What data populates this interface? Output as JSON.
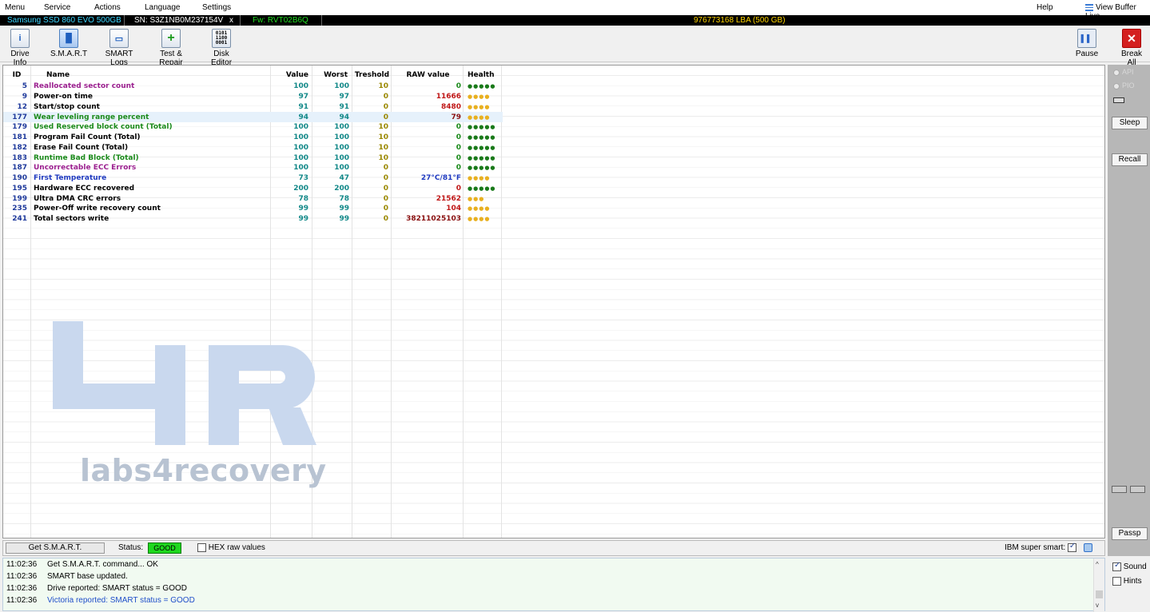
{
  "menu": [
    "Menu",
    "Service",
    "Actions",
    "Language",
    "Settings"
  ],
  "menu_right": {
    "help": "Help",
    "view_buffer": "View Buffer Live"
  },
  "drive": {
    "model": "Samsung SSD 860 EVO 500GB",
    "serial": "SN: S3Z1NB0M237154V",
    "close": "x",
    "firmware": "Fw: RVT02B6Q",
    "lba": "976773168 LBA (500 GB)"
  },
  "toolbar": {
    "drive_info": "Drive Info",
    "smart": "S.M.A.R.T",
    "smart_logs": "SMART Logs",
    "test_repair": "Test & Repair",
    "disk_editor": "Disk Editor",
    "pause": "Pause",
    "break_all": "Break All"
  },
  "table": {
    "headers": [
      "ID",
      "Name",
      "Value",
      "Worst",
      "Treshold",
      "RAW value",
      "Health"
    ],
    "rows": [
      {
        "id": "5",
        "name": "Reallocated sector count",
        "value": "100",
        "worst": "100",
        "threshold": "10",
        "raw": "0",
        "health": "●●●●●",
        "name_color": "#9b1f8f",
        "raw_color": "#1a8a1a",
        "health_color": "#1a7a1a"
      },
      {
        "id": "9",
        "name": "Power-on time",
        "value": "97",
        "worst": "97",
        "threshold": "0",
        "raw": "11666",
        "health": "●●●●",
        "name_color": "#000000",
        "raw_color": "#c01818",
        "health_color": "#e8b020"
      },
      {
        "id": "12",
        "name": "Start/stop count",
        "value": "91",
        "worst": "91",
        "threshold": "0",
        "raw": "8480",
        "health": "●●●●",
        "name_color": "#000000",
        "raw_color": "#c01818",
        "health_color": "#e8b020"
      },
      {
        "id": "177",
        "name": "Wear leveling range percent",
        "value": "94",
        "worst": "94",
        "threshold": "0",
        "raw": "79",
        "health": "●●●●",
        "name_color": "#1a8a1a",
        "raw_color": "#8a1010",
        "health_color": "#e8b020"
      },
      {
        "id": "179",
        "name": "Used Reserved block count (Total)",
        "value": "100",
        "worst": "100",
        "threshold": "10",
        "raw": "0",
        "health": "●●●●●",
        "name_color": "#1a8a1a",
        "raw_color": "#1a8a1a",
        "health_color": "#1a7a1a"
      },
      {
        "id": "181",
        "name": "Program Fail Count (Total)",
        "value": "100",
        "worst": "100",
        "threshold": "10",
        "raw": "0",
        "health": "●●●●●",
        "name_color": "#000000",
        "raw_color": "#1a8a1a",
        "health_color": "#1a7a1a"
      },
      {
        "id": "182",
        "name": "Erase Fail Count (Total)",
        "value": "100",
        "worst": "100",
        "threshold": "10",
        "raw": "0",
        "health": "●●●●●",
        "name_color": "#000000",
        "raw_color": "#1a8a1a",
        "health_color": "#1a7a1a"
      },
      {
        "id": "183",
        "name": "Runtime Bad Block (Total)",
        "value": "100",
        "worst": "100",
        "threshold": "10",
        "raw": "0",
        "health": "●●●●●",
        "name_color": "#1a8a1a",
        "raw_color": "#1a8a1a",
        "health_color": "#1a7a1a"
      },
      {
        "id": "187",
        "name": "Uncorrectable ECC Errors",
        "value": "100",
        "worst": "100",
        "threshold": "0",
        "raw": "0",
        "health": "●●●●●",
        "name_color": "#9b1f8f",
        "raw_color": "#1a8a1a",
        "health_color": "#1a7a1a"
      },
      {
        "id": "190",
        "name": "First Temperature",
        "value": "73",
        "worst": "47",
        "threshold": "0",
        "raw": "27°C/81°F",
        "health": "●●●●",
        "name_color": "#1f3ac0",
        "raw_color": "#1f3ac0",
        "health_color": "#e8b020"
      },
      {
        "id": "195",
        "name": "Hardware ECC recovered",
        "value": "200",
        "worst": "200",
        "threshold": "0",
        "raw": "0",
        "health": "●●●●●",
        "name_color": "#000000",
        "raw_color": "#c01818",
        "health_color": "#1a7a1a"
      },
      {
        "id": "199",
        "name": "Ultra DMA CRC errors",
        "value": "78",
        "worst": "78",
        "threshold": "0",
        "raw": "21562",
        "health": "●●●",
        "name_color": "#000000",
        "raw_color": "#c01818",
        "health_color": "#e8b020"
      },
      {
        "id": "235",
        "name": "Power-Off write recovery count",
        "value": "99",
        "worst": "99",
        "threshold": "0",
        "raw": "104",
        "health": "●●●●",
        "name_color": "#000000",
        "raw_color": "#c01818",
        "health_color": "#e8b020"
      },
      {
        "id": "241",
        "name": "Total sectors write",
        "value": "99",
        "worst": "99",
        "threshold": "0",
        "raw": "38211025103",
        "health": "●●●●",
        "name_color": "#000000",
        "raw_color": "#8a1010",
        "health_color": "#e8b020"
      }
    ],
    "highlighted_row": "177"
  },
  "watermark": {
    "text": "labs4recovery"
  },
  "statusbar": {
    "get_smart": "Get S.M.A.R.T.",
    "status_label": "Status:",
    "status_value": "GOOD",
    "hex_label": "HEX raw values",
    "hex_checked": false,
    "ibm_label": "IBM super smart:",
    "ibm_checked": true
  },
  "log": [
    {
      "time": "11:02:36",
      "msg": "Get S.M.A.R.T. command... OK",
      "blue": false
    },
    {
      "time": "11:02:36",
      "msg": "SMART base updated.",
      "blue": false
    },
    {
      "time": "11:02:36",
      "msg": "Drive reported: SMART status = GOOD",
      "blue": false
    },
    {
      "time": "11:02:36",
      "msg": "Victoria reported: SMART status = GOOD",
      "blue": true
    }
  ],
  "right_panel": {
    "api": "API",
    "pio": "PIO",
    "sleep": "Sleep",
    "recall": "Recall",
    "passp": "Passp",
    "sound": "Sound",
    "sound_checked": true,
    "hints": "Hints",
    "hints_checked": false
  }
}
